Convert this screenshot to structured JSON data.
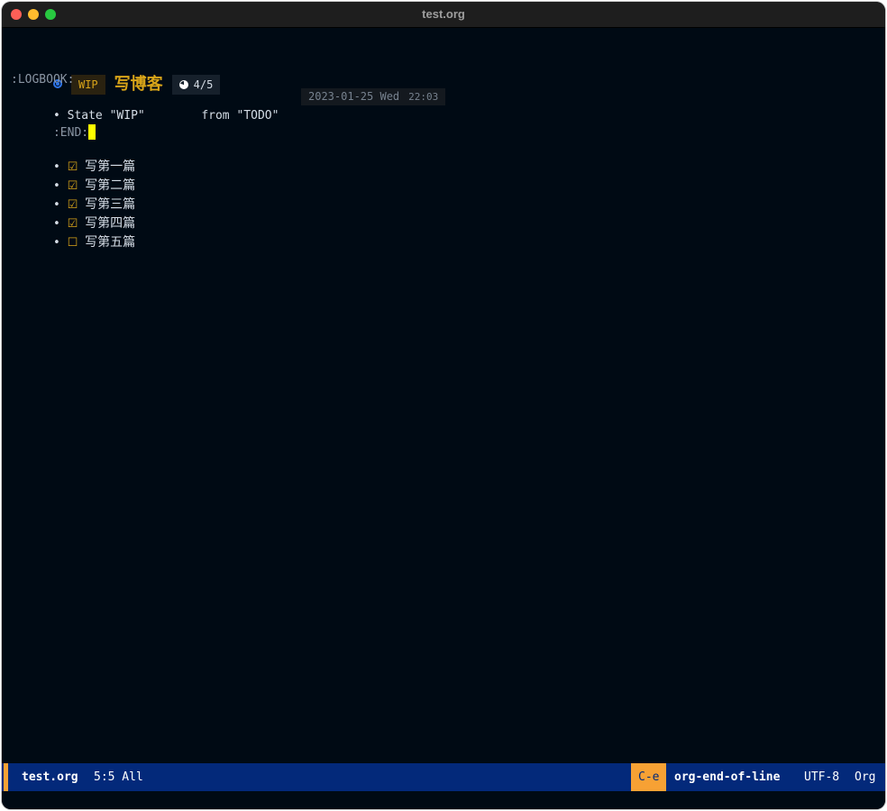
{
  "window": {
    "title": "test.org"
  },
  "heading": {
    "todo": "WIP",
    "title": "写博客",
    "progress": "4/5"
  },
  "logbook": {
    "start": ":LOGBOOK:",
    "entry_bullet": "•",
    "entry_text": "State \"WIP\"        from \"TODO\"",
    "timestamp_date": "2023-01-25 Wed",
    "timestamp_time": "22:03",
    "end": ":END:"
  },
  "checklist": {
    "bullet": "•",
    "items": [
      {
        "checkbox": "☑",
        "label": "写第一篇"
      },
      {
        "checkbox": "☑",
        "label": "写第二篇"
      },
      {
        "checkbox": "☑",
        "label": "写第三篇"
      },
      {
        "checkbox": "☑",
        "label": "写第四篇"
      },
      {
        "checkbox": "☐",
        "label": "写第五篇"
      }
    ]
  },
  "modeline": {
    "buffer_name": "test.org",
    "position": "5:5 All",
    "key": "C-e",
    "command": "org-end-of-line",
    "encoding": "UTF-8",
    "mode": "Org"
  },
  "colors": {
    "background": "#000a14",
    "accent": "#d8a419",
    "modeline": "#03297a",
    "modeline_accent": "#f7a134",
    "cursor": "#ffff00",
    "bullet": "#2e73e6"
  },
  "icons": {
    "heading_bullet": "circle-bullet-icon",
    "progress": "pie-progress-icon",
    "checked": "checkbox-checked-icon",
    "unchecked": "checkbox-unchecked-icon"
  }
}
